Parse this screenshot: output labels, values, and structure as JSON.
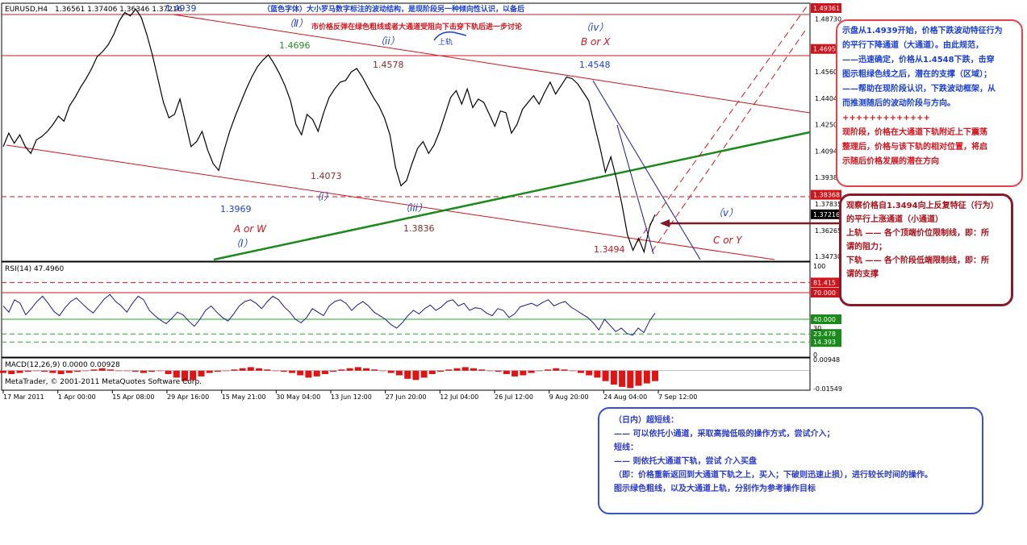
{
  "header": {
    "symbol_tf": "EURUSD,H4",
    "ohlc": "1.36561 1.37406 1.36346 1.37216",
    "annotation_blue": "（蓝色字体）大小罗马数字标注的波动结构，是现阶段另一种倾向性认识，以备后",
    "annotation_red": "市价格反弹在绿色粗线或者大通道受阻向下击穿下轨后进一步讨论",
    "upper_rail_tag": "上轨"
  },
  "colors": {
    "price_line": "#000000",
    "channel_red": "#d0141c",
    "green_trend": "#1a8a1a",
    "navy_line": "#1a1a8a",
    "rsi_line": "#1a1a8a",
    "macd_hist": "#e01414",
    "hline_red": "#d0141c",
    "grid_label_bg_red": "#d0141c",
    "grid_label_bg_black": "#000000",
    "label_blue": "#2a3ac8",
    "label_green": "#2a8a2a"
  },
  "chart_data": [
    {
      "type": "line",
      "name": "EURUSD H4 price",
      "title": "",
      "xlabel": "",
      "ylabel": "",
      "x": [
        "17 Mar 2011",
        "1 Apr 00:00",
        "15 Apr 08:00",
        "29 Apr 16:00",
        "15 May 21:00",
        "30 May 04:00",
        "13 Jun 12:00",
        "27 Jun 20:00",
        "12 Jul 04:00",
        "26 Jul 12:00",
        "9 Aug 20:00",
        "24 Aug 04:00",
        "7 Sep 12:00"
      ],
      "close_path": [
        1.412,
        1.42,
        1.414,
        1.419,
        1.412,
        1.408,
        1.416,
        1.418,
        1.421,
        1.425,
        1.43,
        1.427,
        1.436,
        1.441,
        1.447,
        1.452,
        1.458,
        1.465,
        1.468,
        1.472,
        1.478,
        1.486,
        1.491,
        1.489,
        1.493,
        1.488,
        1.478,
        1.466,
        1.452,
        1.438,
        1.429,
        1.431,
        1.44,
        1.426,
        1.412,
        1.415,
        1.421,
        1.41,
        1.402,
        1.398,
        1.41,
        1.421,
        1.43,
        1.438,
        1.446,
        1.453,
        1.459,
        1.463,
        1.466,
        1.461,
        1.455,
        1.448,
        1.439,
        1.425,
        1.419,
        1.431,
        1.428,
        1.421,
        1.432,
        1.441,
        1.446,
        1.45,
        1.451,
        1.456,
        1.458,
        1.453,
        1.447,
        1.441,
        1.436,
        1.429,
        1.419,
        1.4,
        1.389,
        1.392,
        1.402,
        1.411,
        1.415,
        1.408,
        1.413,
        1.421,
        1.431,
        1.441,
        1.445,
        1.437,
        1.446,
        1.435,
        1.44,
        1.438,
        1.431,
        1.424,
        1.433,
        1.432,
        1.42,
        1.425,
        1.434,
        1.438,
        1.442,
        1.437,
        1.444,
        1.45,
        1.443,
        1.448,
        1.453,
        1.452,
        1.449,
        1.444,
        1.439,
        1.425,
        1.412,
        1.397,
        1.406,
        1.393,
        1.378,
        1.36,
        1.351,
        1.358,
        1.35,
        1.365,
        1.372
      ],
      "ylim": [
        1.3455,
        1.4955
      ],
      "price_axis_ticks": [
        "1.48730",
        "1.46950",
        "1.45600",
        "1.44045",
        "1.42500",
        "1.40945",
        "1.39385",
        "1.37835",
        "1.36265",
        "1.34730"
      ],
      "price_markers": [
        {
          "label": "1.49361",
          "kind": "red"
        },
        {
          "label": "1.46952",
          "kind": "red"
        },
        {
          "label": "1.38368",
          "kind": "red"
        },
        {
          "label": "1.37216",
          "kind": "black"
        }
      ],
      "labels": {
        "v1": "1.4939",
        "v2": "1.4696",
        "v3": "1.4578",
        "v4": "1.4548",
        "v5": "1.4073",
        "v6": "1.3969",
        "v7": "1.3836",
        "v8": "1.3494",
        "w1": "（Ⅱ）",
        "w2": "（ii）",
        "w3": "（iv）",
        "w4": "B or X",
        "w5": "（i）",
        "w6": "（iii）",
        "w7": "A or W",
        "w8": "（Ⅰ）",
        "w9": "（v）",
        "w10": "C or Y"
      }
    },
    {
      "type": "line",
      "name": "RSI(14)",
      "title": "RSI(14) 47.4960",
      "xlabel": "",
      "ylabel": "",
      "ylim": [
        0,
        100
      ],
      "axis_ticks": [
        "100",
        "30",
        "0"
      ],
      "levels": [
        {
          "label": "81.415",
          "kind": "red",
          "style": "dash"
        },
        {
          "label": "70.000",
          "kind": "red",
          "style": "solid"
        },
        {
          "label": "40.000",
          "kind": "green",
          "style": "solid"
        },
        {
          "label": "23.478",
          "kind": "green",
          "style": "dash"
        },
        {
          "label": "14.393",
          "kind": "green",
          "style": "dash"
        }
      ],
      "values": [
        55,
        48,
        62,
        58,
        45,
        52,
        60,
        66,
        58,
        49,
        44,
        53,
        60,
        64,
        58,
        52,
        47,
        55,
        63,
        68,
        60,
        55,
        48,
        58,
        66,
        62,
        50,
        44,
        39,
        35,
        41,
        48,
        45,
        38,
        32,
        40,
        50,
        55,
        48,
        42,
        38,
        46,
        55,
        60,
        62,
        58,
        52,
        60,
        66,
        62,
        54,
        48,
        40,
        36,
        42,
        52,
        48,
        44,
        55,
        60,
        62,
        58,
        50,
        56,
        60,
        55,
        48,
        44,
        40,
        34,
        30,
        36,
        44,
        50,
        46,
        52,
        56,
        50,
        54,
        60,
        62,
        55,
        58,
        50,
        53,
        52,
        47,
        44,
        52,
        50,
        42,
        46,
        54,
        56,
        58,
        55,
        59,
        62,
        55,
        58,
        60,
        54,
        50,
        46,
        42,
        36,
        28,
        40,
        33,
        26,
        30,
        24,
        22,
        30,
        25,
        38,
        47
      ],
      "current": "47.4960"
    },
    {
      "type": "bar",
      "name": "MACD(12,26,9)",
      "title": "MACD(12,26,9)  0.0000  0.00928",
      "xlabel": "",
      "ylabel": "",
      "ylim": [
        -0.0154,
        0.0095
      ],
      "axis_ticks": [
        "0.00948",
        "-0.01549"
      ],
      "values": [
        -0.002,
        -0.003,
        -0.002,
        -0.001,
        0,
        -0.001,
        -0.002,
        -0.003,
        -0.002,
        -0.001,
        0,
        0.001,
        0.002,
        0.001,
        0,
        0,
        -0.001,
        -0.002,
        -0.001,
        0,
        -0.003,
        -0.006,
        -0.009,
        -0.008,
        -0.005,
        -0.002,
        -0.001,
        0,
        0.001,
        0.002,
        0.003,
        0.002,
        0.001,
        0,
        -0.001,
        -0.002,
        -0.004,
        -0.006,
        -0.005,
        -0.003,
        -0.001,
        0.001,
        0.002,
        0.003,
        0.002,
        0.001,
        0,
        -0.002,
        -0.004,
        -0.007,
        -0.008,
        -0.006,
        -0.003,
        -0.001,
        0.001,
        0.002,
        0.003,
        0.002,
        0.001,
        0,
        -0.001,
        -0.003,
        -0.005,
        -0.004,
        -0.002,
        0,
        0.001,
        0.002,
        0.001,
        0,
        -0.002,
        -0.004,
        -0.006,
        -0.009,
        -0.012,
        -0.014,
        -0.015,
        -0.013,
        -0.011,
        -0.009
      ]
    }
  ],
  "footer": {
    "copyright": "MetaTrader, © 2001-2011 MetaQuotes Software Corp."
  },
  "notes": {
    "top_right": {
      "line1": "示盘从1.4939开始，价格下跌波动特征行为",
      "line2": "的平行下降通道（大通道）。由此规范，",
      "line3": "——迅速确定，价格从1.4548下跌，击穿",
      "line4": "图示粗绿色线之后，潜在的支撑（区域）；",
      "line5": "——帮助在现阶段认识，下跌波动框架，从",
      "line6": "而推测随后的波动阶段与方向。",
      "line7": "+++++++++++++",
      "line8": "现阶段，价格在大通道下轨附近上下震荡",
      "line9": "整理后，价格与该下轨的相对位置，将启",
      "line10": "示随后价格发展的潜在方向"
    },
    "channel": {
      "line1": "观察价格自1.3494向上反复特征（行为）",
      "line2": "的平行上涨通道（小通道）",
      "line3": "上轨 —— 各个顶端价位限制线，即：所",
      "line4": "谓的阻力；",
      "line5": "下轨 —— 各个阶段低端限制线，即：所",
      "line6": "谓的支撑"
    },
    "bottom": {
      "line1": "（日内）超短线：",
      "line2": "—— 可以依托小通道，采取高抛低吸的操作方式，尝试介入；",
      "line3": "短线：",
      "line4": "—— 则依托大通道下轨，尝试 介入买盘",
      "line5": "（即：价格重新返回到大通道下轨之上，买入；下破则迅速止损），进行较长时间的操作。",
      "line6": "图示绿色粗线，以及大通道上轨，分别作为参考操作目标"
    }
  }
}
